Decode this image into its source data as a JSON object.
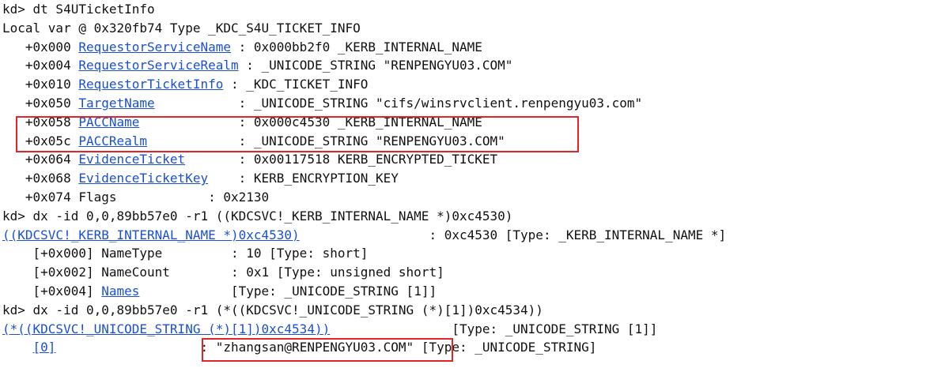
{
  "console": {
    "lines": [
      {
        "segments": [
          {
            "t": "kd> dt S4UTicketInfo"
          }
        ]
      },
      {
        "segments": [
          {
            "t": "Local var @ 0x320fb74 Type _KDC_S4U_TICKET_INFO"
          }
        ]
      },
      {
        "segments": [
          {
            "t": "   +0x000 "
          },
          {
            "t": "RequestorServiceName",
            "link": true,
            "name": "field-link-requestor-service-name"
          },
          {
            "t": " : 0x000bb2f0 _KERB_INTERNAL_NAME"
          }
        ]
      },
      {
        "segments": [
          {
            "t": "   +0x004 "
          },
          {
            "t": "RequestorServiceRealm",
            "link": true,
            "name": "field-link-requestor-service-realm"
          },
          {
            "t": " : _UNICODE_STRING \"RENPENGYU03.COM\""
          }
        ]
      },
      {
        "segments": [
          {
            "t": "   +0x010 "
          },
          {
            "t": "RequestorTicketInfo",
            "link": true,
            "name": "field-link-requestor-ticket-info"
          },
          {
            "t": " : _KDC_TICKET_INFO"
          }
        ]
      },
      {
        "segments": [
          {
            "t": "   +0x050 "
          },
          {
            "t": "TargetName",
            "link": true,
            "name": "field-link-target-name"
          },
          {
            "t": "           : _UNICODE_STRING \"cifs/winsrvclient.renpengyu03.com\""
          }
        ]
      },
      {
        "segments": [
          {
            "t": "   +0x058 "
          },
          {
            "t": "PACCName",
            "link": true,
            "name": "field-link-pac-cname"
          },
          {
            "t": "             : 0x000c4530 _KERB_INTERNAL_NAME"
          }
        ]
      },
      {
        "segments": [
          {
            "t": "   +0x05c "
          },
          {
            "t": "PACCRealm",
            "link": true,
            "name": "field-link-pac-crealm"
          },
          {
            "t": "            : _UNICODE_STRING \"RENPENGYU03.COM\""
          }
        ]
      },
      {
        "segments": [
          {
            "t": "   +0x064 "
          },
          {
            "t": "EvidenceTicket",
            "link": true,
            "name": "field-link-evidence-ticket"
          },
          {
            "t": "       : 0x00117518 KERB_ENCRYPTED_TICKET"
          }
        ]
      },
      {
        "segments": [
          {
            "t": "   +0x068 "
          },
          {
            "t": "EvidenceTicketKey",
            "link": true,
            "name": "field-link-evidence-ticket-key"
          },
          {
            "t": "    : KERB_ENCRYPTION_KEY"
          }
        ]
      },
      {
        "segments": [
          {
            "t": "   +0x074 Flags            : 0x2130"
          }
        ]
      },
      {
        "segments": [
          {
            "t": "kd> dx -id 0,0,89bb57e0 -r1 ((KDCSVC!_KERB_INTERNAL_NAME *)0xc4530)"
          }
        ]
      },
      {
        "segments": [
          {
            "t": "((KDCSVC!_KERB_INTERNAL_NAME *)0xc4530)",
            "link": true,
            "name": "dx-link-kerb-internal-name"
          },
          {
            "t": "                 : 0xc4530 [Type: _KERB_INTERNAL_NAME *]"
          }
        ]
      },
      {
        "segments": [
          {
            "t": "    [+0x000] NameType         : 10 [Type: short]"
          }
        ]
      },
      {
        "segments": [
          {
            "t": "    [+0x002] NameCount        : 0x1 [Type: unsigned short]"
          }
        ]
      },
      {
        "segments": [
          {
            "t": "    [+0x004] "
          },
          {
            "t": "Names",
            "link": true,
            "name": "field-link-names"
          },
          {
            "t": "            [Type: _UNICODE_STRING [1]]"
          }
        ]
      },
      {
        "segments": [
          {
            "t": "kd> dx -id 0,0,89bb57e0 -r1 (*((KDCSVC!_UNICODE_STRING (*)[1])0xc4534))"
          }
        ]
      },
      {
        "segments": [
          {
            "t": "(*((KDCSVC!_UNICODE_STRING (*)[1])0xc4534))",
            "link": true,
            "name": "dx-link-unicode-string-array"
          },
          {
            "t": "                [Type: _UNICODE_STRING [1]]"
          }
        ]
      },
      {
        "segments": [
          {
            "t": "    "
          },
          {
            "t": "[0]",
            "link": true,
            "name": "array-index-link-0"
          },
          {
            "t": "                   : \"zhangsan@RENPENGYU03.COM\" [Type: _UNICODE_STRING]"
          }
        ]
      }
    ]
  },
  "highlight": {
    "color": "#e0262b"
  }
}
